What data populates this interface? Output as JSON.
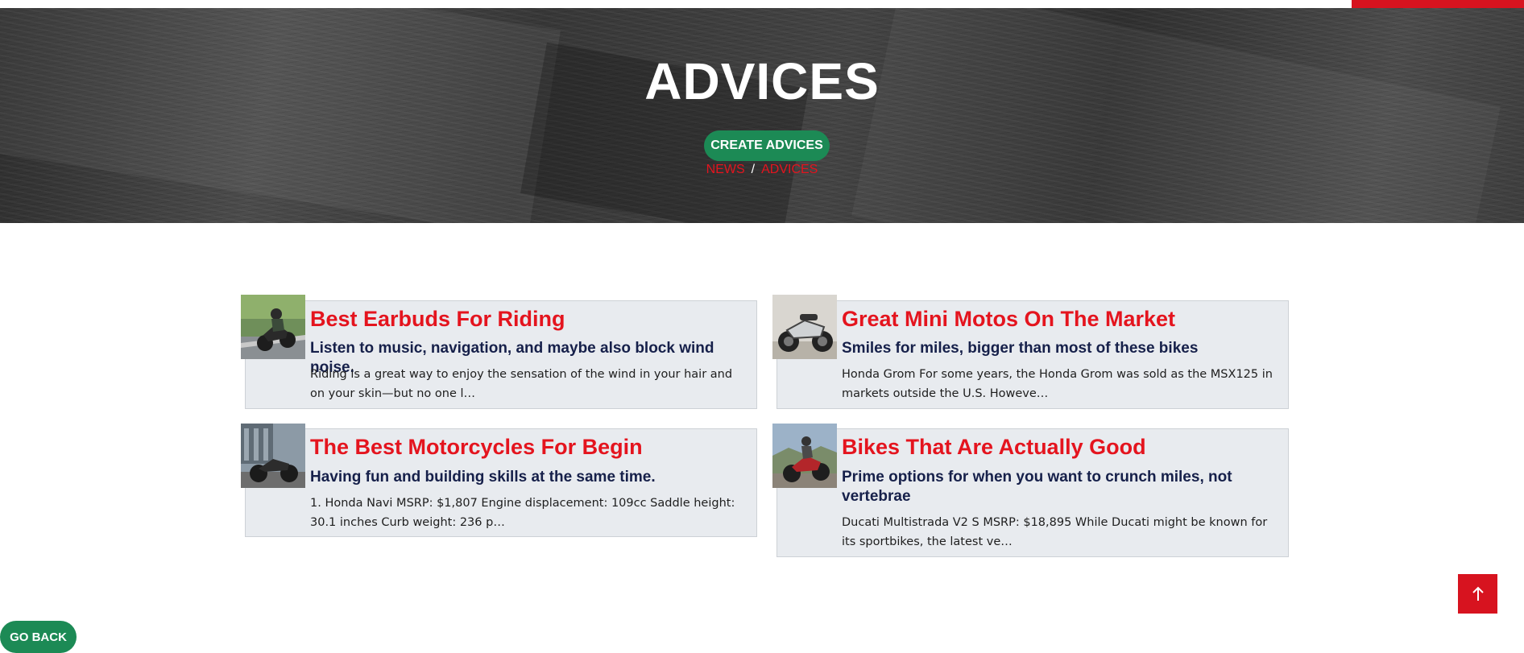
{
  "hero": {
    "title": "ADVICES",
    "create_button": "CREATE ADVICES",
    "breadcrumb": {
      "item1": "NEWS",
      "separator": "/",
      "item2": "ADVICES"
    }
  },
  "articles": [
    {
      "title": "Best Earbuds For Riding",
      "subtitle": "Listen to music, navigation, and maybe also block wind noise.",
      "excerpt": "Riding is a great way to enjoy the sensation of the wind in your hair and on your skin—but no one l…"
    },
    {
      "title": "Great Mini Motos On The Market",
      "subtitle": "Smiles for miles, bigger than most of these bikes",
      "excerpt": "Honda Grom For some years, the Honda Grom was sold as the MSX125 in markets outside the U.S. Howeve…"
    },
    {
      "title": "The Best Motorcycles For Begin",
      "subtitle": "Having fun and building skills at the same time.",
      "excerpt": "1. Honda Navi MSRP: $1,807 Engine displacement: 109cc Saddle height: 30.1 inches Curb weight: 236 p…"
    },
    {
      "title": "Bikes That Are Actually Good",
      "subtitle": "Prime options for when you want to crunch miles, not vertebrae",
      "excerpt": "Ducati Multistrada V2 S MSRP: $18,895 While Ducati might be known for its sportbikes, the latest ve…"
    }
  ],
  "footer": {
    "go_back": "GO BACK",
    "to_top_icon": "arrow-up-icon"
  },
  "colors": {
    "accent_red": "#d7131f",
    "title_red": "#e4141e",
    "green": "#1c8a55",
    "navy": "#16204a",
    "card_bg": "#e8ebef"
  }
}
